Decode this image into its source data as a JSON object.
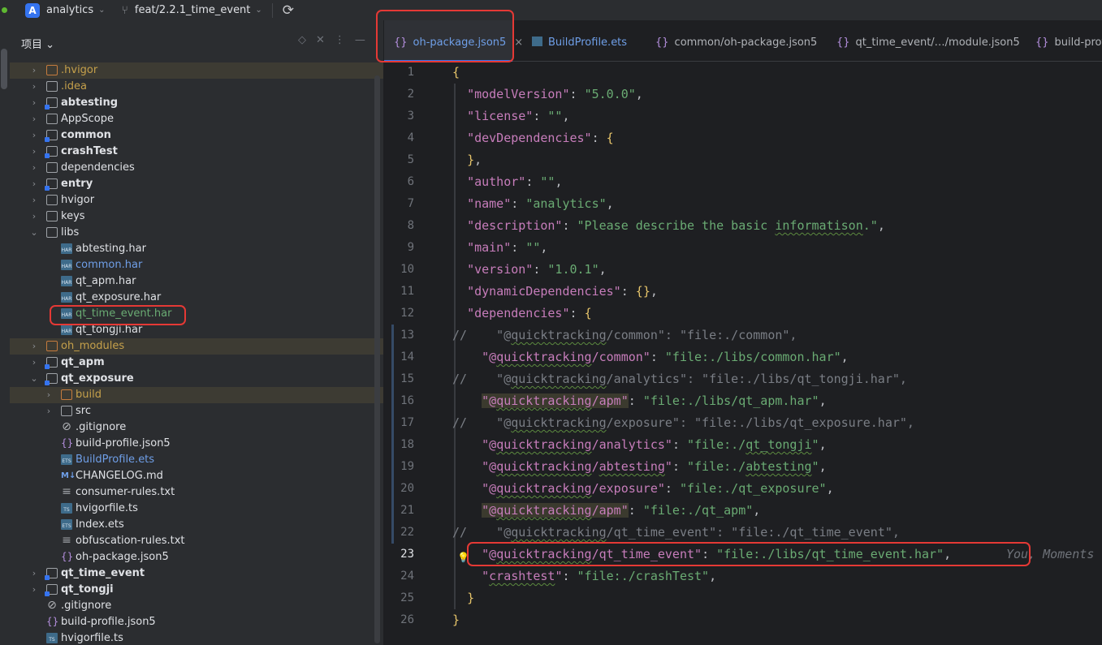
{
  "toolbar": {
    "project_badge": "A",
    "project_name": "analytics",
    "branch": "feat/2.2.1_time_event"
  },
  "panel": {
    "title": "项目"
  },
  "tree": [
    {
      "label": ".hvigor",
      "indent": 1,
      "arrow": "›",
      "icon": "folder-orange",
      "style": "yellow",
      "hl": true
    },
    {
      "label": ".idea",
      "indent": 1,
      "arrow": "›",
      "icon": "folder",
      "style": "yellow",
      "hl": false
    },
    {
      "label": "abtesting",
      "indent": 1,
      "arrow": "›",
      "icon": "folder-mod",
      "style": "bold",
      "hl": false
    },
    {
      "label": "AppScope",
      "indent": 1,
      "arrow": "›",
      "icon": "folder",
      "style": "normal",
      "hl": false
    },
    {
      "label": "common",
      "indent": 1,
      "arrow": "›",
      "icon": "folder-mod",
      "style": "bold",
      "hl": false
    },
    {
      "label": "crashTest",
      "indent": 1,
      "arrow": "›",
      "icon": "folder-mod",
      "style": "bold",
      "hl": false
    },
    {
      "label": "dependencies",
      "indent": 1,
      "arrow": "›",
      "icon": "folder",
      "style": "normal",
      "hl": false
    },
    {
      "label": "entry",
      "indent": 1,
      "arrow": "›",
      "icon": "folder-mod",
      "style": "bold",
      "hl": false
    },
    {
      "label": "hvigor",
      "indent": 1,
      "arrow": "›",
      "icon": "folder",
      "style": "normal",
      "hl": false
    },
    {
      "label": "keys",
      "indent": 1,
      "arrow": "›",
      "icon": "folder",
      "style": "normal",
      "hl": false
    },
    {
      "label": "libs",
      "indent": 1,
      "arrow": "⌄",
      "icon": "folder",
      "style": "normal",
      "hl": false
    },
    {
      "label": "abtesting.har",
      "indent": 2,
      "arrow": "",
      "icon": "har",
      "style": "normal",
      "hl": false
    },
    {
      "label": "common.har",
      "indent": 2,
      "arrow": "",
      "icon": "har",
      "style": "blue",
      "hl": false
    },
    {
      "label": "qt_apm.har",
      "indent": 2,
      "arrow": "",
      "icon": "har",
      "style": "normal",
      "hl": false
    },
    {
      "label": "qt_exposure.har",
      "indent": 2,
      "arrow": "",
      "icon": "har",
      "style": "normal",
      "hl": false
    },
    {
      "label": "qt_time_event.har",
      "indent": 2,
      "arrow": "",
      "icon": "har",
      "style": "green",
      "hl": false
    },
    {
      "label": "qt_tongji.har",
      "indent": 2,
      "arrow": "",
      "icon": "har",
      "style": "normal",
      "hl": false
    },
    {
      "label": "oh_modules",
      "indent": 1,
      "arrow": "›",
      "icon": "folder-orange",
      "style": "yellow",
      "hl": true
    },
    {
      "label": "qt_apm",
      "indent": 1,
      "arrow": "›",
      "icon": "folder-mod",
      "style": "bold",
      "hl": false
    },
    {
      "label": "qt_exposure",
      "indent": 1,
      "arrow": "⌄",
      "icon": "folder-mod",
      "style": "bold",
      "hl": false
    },
    {
      "label": "build",
      "indent": 2,
      "arrow": "›",
      "icon": "folder-orange",
      "style": "yellow",
      "hl": true
    },
    {
      "label": "src",
      "indent": 2,
      "arrow": "›",
      "icon": "folder",
      "style": "normal",
      "hl": false
    },
    {
      "label": ".gitignore",
      "indent": 2,
      "arrow": "",
      "icon": "ignore",
      "style": "normal",
      "hl": false
    },
    {
      "label": "build-profile.json5",
      "indent": 2,
      "arrow": "",
      "icon": "json",
      "style": "normal",
      "hl": false
    },
    {
      "label": "BuildProfile.ets",
      "indent": 2,
      "arrow": "",
      "icon": "ets",
      "style": "blue",
      "hl": false
    },
    {
      "label": "CHANGELOG.md",
      "indent": 2,
      "arrow": "",
      "icon": "md",
      "style": "normal",
      "hl": false
    },
    {
      "label": "consumer-rules.txt",
      "indent": 2,
      "arrow": "",
      "icon": "txt",
      "style": "normal",
      "hl": false
    },
    {
      "label": "hvigorfile.ts",
      "indent": 2,
      "arrow": "",
      "icon": "ts",
      "style": "normal",
      "hl": false
    },
    {
      "label": "Index.ets",
      "indent": 2,
      "arrow": "",
      "icon": "ets",
      "style": "normal",
      "hl": false
    },
    {
      "label": "obfuscation-rules.txt",
      "indent": 2,
      "arrow": "",
      "icon": "txt",
      "style": "normal",
      "hl": false
    },
    {
      "label": "oh-package.json5",
      "indent": 2,
      "arrow": "",
      "icon": "json",
      "style": "normal",
      "hl": false
    },
    {
      "label": "qt_time_event",
      "indent": 1,
      "arrow": "›",
      "icon": "folder-mod",
      "style": "bold",
      "hl": false
    },
    {
      "label": "qt_tongji",
      "indent": 1,
      "arrow": "›",
      "icon": "folder-mod",
      "style": "bold",
      "hl": false
    },
    {
      "label": ".gitignore",
      "indent": 1,
      "arrow": "",
      "icon": "ignore",
      "style": "normal",
      "hl": false
    },
    {
      "label": "build-profile.json5",
      "indent": 1,
      "arrow": "",
      "icon": "json",
      "style": "normal",
      "hl": false
    },
    {
      "label": "hvigorfile.ts",
      "indent": 1,
      "arrow": "",
      "icon": "ts",
      "style": "normal",
      "hl": false
    }
  ],
  "tabs": [
    {
      "label": "oh-package.json5",
      "icon": "json",
      "active": true
    },
    {
      "label": "BuildProfile.ets",
      "icon": "ets",
      "active": false
    },
    {
      "label": "common/oh-package.json5",
      "icon": "json",
      "active": false
    },
    {
      "label": "qt_time_event/…/module.json5",
      "icon": "json",
      "active": false
    },
    {
      "label": "build-profil",
      "icon": "json",
      "active": false
    }
  ],
  "code_lines": [
    {
      "n": "1",
      "t": "{"
    },
    {
      "n": "2",
      "t": "  \"modelVersion\": \"5.0.0\","
    },
    {
      "n": "3",
      "t": "  \"license\": \"\","
    },
    {
      "n": "4",
      "t": "  \"devDependencies\": {"
    },
    {
      "n": "5",
      "t": "  },"
    },
    {
      "n": "6",
      "t": "  \"author\": \"\","
    },
    {
      "n": "7",
      "t": "  \"name\": \"analytics\","
    },
    {
      "n": "8",
      "t": "  \"description\": \"Please describe the basic informatison.\","
    },
    {
      "n": "9",
      "t": "  \"main\": \"\","
    },
    {
      "n": "10",
      "t": "  \"version\": \"1.0.1\","
    },
    {
      "n": "11",
      "t": "  \"dynamicDependencies\": {},"
    },
    {
      "n": "12",
      "t": "  \"dependencies\": {"
    },
    {
      "n": "13",
      "t": "//    \"@quicktracking/common\": \"file:./common\","
    },
    {
      "n": "14",
      "t": "    \"@quicktracking/common\": \"file:./libs/common.har\","
    },
    {
      "n": "15",
      "t": "//    \"@quicktracking/analytics\": \"file:./libs/qt_tongji.har\","
    },
    {
      "n": "16",
      "t": "    \"@quicktracking/apm\": \"file:./libs/qt_apm.har\","
    },
    {
      "n": "17",
      "t": "//    \"@quicktracking/exposure\": \"file:./libs/qt_exposure.har\","
    },
    {
      "n": "18",
      "t": "    \"@quicktracking/analytics\": \"file:./qt_tongji\","
    },
    {
      "n": "19",
      "t": "    \"@quicktracking/abtesting\": \"file:./abtesting\","
    },
    {
      "n": "20",
      "t": "    \"@quicktracking/exposure\": \"file:./qt_exposure\","
    },
    {
      "n": "21",
      "t": "    \"@quicktracking/apm\": \"file:./qt_apm\","
    },
    {
      "n": "22",
      "t": "//    \"@quicktracking/qt_time_event\": \"file:./qt_time_event\","
    },
    {
      "n": "23",
      "t": "    \"@quicktracking/qt_time_event\": \"file:./libs/qt_time_event.har\",",
      "hint": "You, Moments"
    },
    {
      "n": "24",
      "t": "    \"crashtest\": \"file:./crashTest\","
    },
    {
      "n": "25",
      "t": "  }"
    },
    {
      "n": "26",
      "t": "}"
    }
  ],
  "colors": {
    "accent": "#3574f0",
    "annotation_red": "#e53935",
    "key_purple": "#c77dbb",
    "string_green": "#6aab73"
  }
}
